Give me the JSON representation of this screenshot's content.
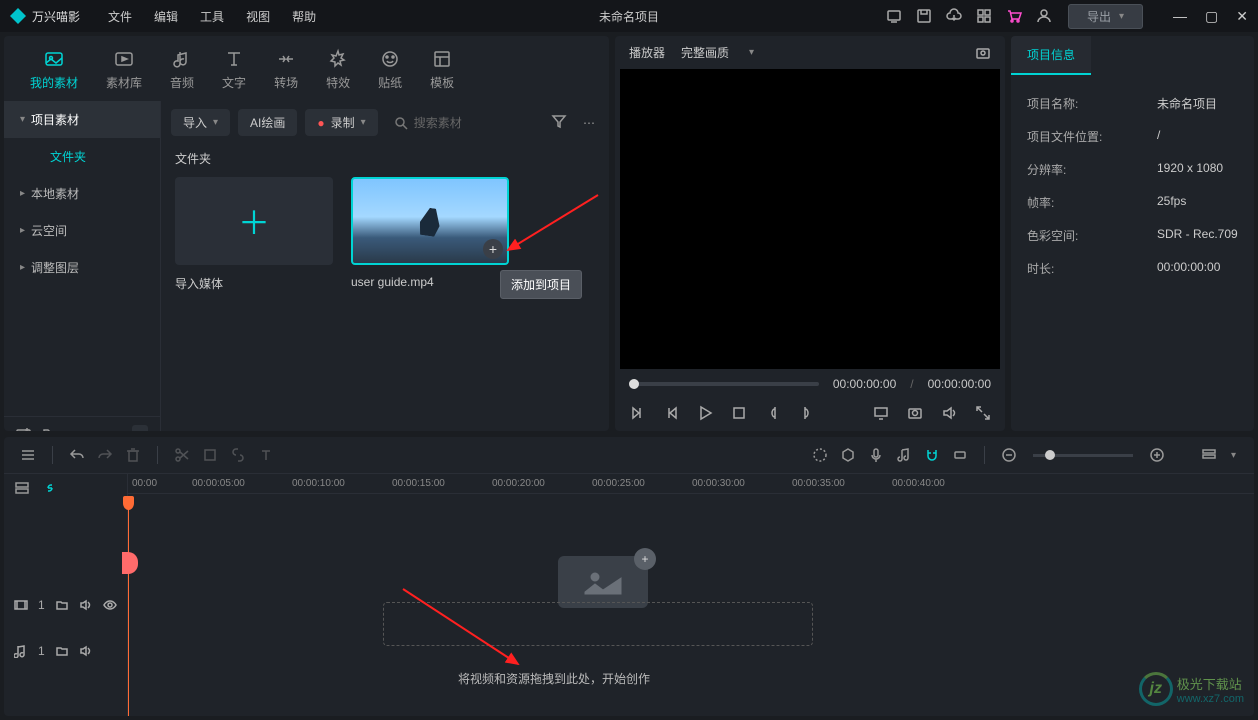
{
  "app": {
    "name": "万兴喵影",
    "project_title": "未命名项目",
    "export": "导出"
  },
  "menu": [
    "文件",
    "编辑",
    "工具",
    "视图",
    "帮助"
  ],
  "tabs": [
    {
      "id": "my-media",
      "label": "我的素材"
    },
    {
      "id": "stock",
      "label": "素材库"
    },
    {
      "id": "audio",
      "label": "音频"
    },
    {
      "id": "text",
      "label": "文字"
    },
    {
      "id": "transition",
      "label": "转场"
    },
    {
      "id": "effect",
      "label": "特效"
    },
    {
      "id": "sticker",
      "label": "贴纸"
    },
    {
      "id": "template",
      "label": "模板"
    }
  ],
  "tree": {
    "root": "项目素材",
    "folder": "文件夹",
    "items": [
      "本地素材",
      "云空间",
      "调整图层"
    ]
  },
  "contentbar": {
    "import": "导入",
    "aidraw": "AI绘画",
    "record": "录制",
    "search_placeholder": "搜索素材"
  },
  "folder_label": "文件夹",
  "thumbs": {
    "import": "导入媒体",
    "video": "user guide.mp4",
    "tooltip": "添加到项目"
  },
  "player": {
    "title": "播放器",
    "quality": "完整画质",
    "time_cur": "00:00:00:00",
    "time_total": "00:00:00:00"
  },
  "info": {
    "tab": "项目信息",
    "rows": [
      {
        "k": "项目名称:",
        "v": "未命名项目"
      },
      {
        "k": "项目文件位置:",
        "v": "/"
      },
      {
        "k": "分辨率:",
        "v": "1920 x 1080"
      },
      {
        "k": "帧率:",
        "v": "25fps"
      },
      {
        "k": "色彩空间:",
        "v": "SDR - Rec.709"
      },
      {
        "k": "时长:",
        "v": "00:00:00:00"
      }
    ]
  },
  "timeline": {
    "ruler": [
      "00:00",
      "00:00:05:00",
      "00:00:10:00",
      "00:00:15:00",
      "00:00:20:00",
      "00:00:25:00",
      "00:00:30:00",
      "00:00:35:00",
      "00:00:40:00"
    ],
    "drop_hint": "将视频和资源拖拽到此处，开始创作",
    "track_counts": {
      "video": "1",
      "audio": "1"
    }
  },
  "watermark": {
    "site": "www.xz7.com",
    "brand": "极光下载站"
  }
}
